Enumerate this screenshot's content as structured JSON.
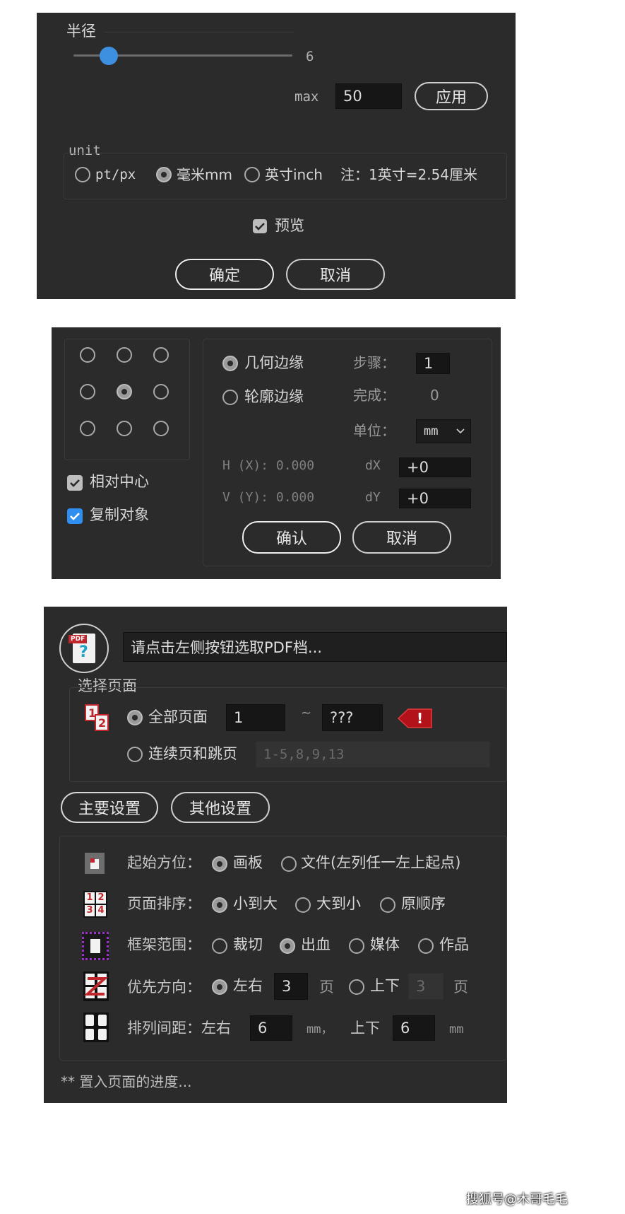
{
  "panel1": {
    "radius_label": "半径",
    "slider_value": "6",
    "slider_level_fraction": 0.16,
    "max_label": "max",
    "max_value": "50",
    "apply_label": "应用",
    "unit_label": "unit",
    "units": [
      {
        "label": "pt/px",
        "selected": false
      },
      {
        "label": "毫米mm",
        "selected": true
      },
      {
        "label": "英寸inch",
        "selected": false
      }
    ],
    "note": "注：1英寸=2.54厘米",
    "preview_label": "预览",
    "preview_checked": true,
    "ok_label": "确定",
    "cancel_label": "取消"
  },
  "panel2": {
    "grid_selected_index": 4,
    "relative_center_label": "相对中心",
    "relative_center_checked": true,
    "copy_object_label": "复制对象",
    "copy_object_checked": true,
    "edge_options": [
      {
        "label": "几何边缘",
        "selected": true
      },
      {
        "label": "轮廓边缘",
        "selected": false
      }
    ],
    "step_label": "步骤：",
    "step_value": "1",
    "done_label": "完成：",
    "done_value": "0",
    "unit_label": "单位：",
    "unit_value": "mm",
    "h_label": "H (X): 0.000",
    "v_label": "V (Y): 0.000",
    "dx_label": "dX",
    "dx_value": "+0",
    "dy_label": "dY",
    "dy_value": "+0",
    "confirm_label": "确认",
    "cancel_label": "取消"
  },
  "panel3": {
    "pdf_badge": "PDF",
    "pdf_question": "?",
    "file_prompt": "请点击左侧按钮选取PDF档...",
    "select_pages_label": "选择页面",
    "all_pages_label": "全部页面",
    "page_from": "1",
    "tilde": "~",
    "page_to": "???",
    "warning_mark": "!",
    "continuous_label": "连续页和跳页",
    "continuous_placeholder": "1-5,8,9,13",
    "page_icon_1": "1",
    "page_icon_2": "2",
    "tabs": [
      {
        "label": "主要设置"
      },
      {
        "label": "其他设置"
      }
    ],
    "start_label": "起始方位：",
    "start_options": [
      {
        "label": "画板",
        "selected": true
      },
      {
        "label": "文件(左列任一左上起点)",
        "selected": false
      }
    ],
    "order_label": "页面排序：",
    "order_options": [
      {
        "label": "小到大",
        "selected": true
      },
      {
        "label": "大到小",
        "selected": false
      },
      {
        "label": "原顺序",
        "selected": false
      }
    ],
    "order_icon_digits": [
      "1",
      "2",
      "3",
      "4"
    ],
    "frame_label": "框架范围：",
    "frame_options": [
      {
        "label": "裁切",
        "selected": false
      },
      {
        "label": "出血",
        "selected": true
      },
      {
        "label": "媒体",
        "selected": false
      },
      {
        "label": "作品",
        "selected": false
      }
    ],
    "direction_label": "优先方向：",
    "lr_label": "左右",
    "lr_value": "3",
    "page_unit_1": "页",
    "ud_label": "上下",
    "ud_value": "3",
    "page_unit_2": "页",
    "spacing_label": "排列间距：左右",
    "spacing_lr_value": "6",
    "spacing_unit_1": "mm，",
    "spacing_ud_label": "上下",
    "spacing_ud_value": "6",
    "spacing_unit_2": "mm",
    "status": "** 置入页面的进度..."
  },
  "watermark": "搜狐号@木哥毛毛",
  "colors": {
    "panel_bg": "#2b2b2b",
    "slider_thumb": "#3d8fe0",
    "checkbox_blue": "#2f8ff0",
    "pdf_red": "#c0272d",
    "warning_red": "#b3121b",
    "frame_purple": "#9b2fc9"
  }
}
